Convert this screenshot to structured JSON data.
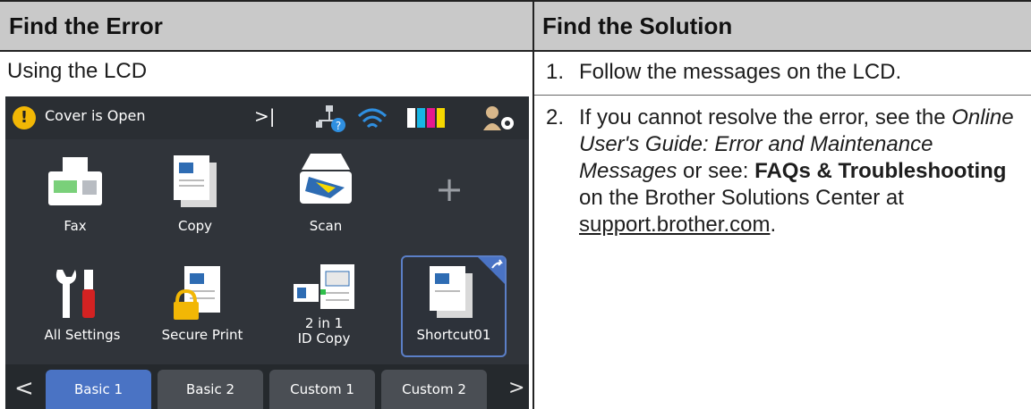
{
  "table": {
    "col1_header": "Find the Error",
    "col2_header": "Find the Solution"
  },
  "error": {
    "intro": "Using the LCD",
    "lcd": {
      "status_message": "Cover is Open",
      "status_forward": ">|",
      "tiles": [
        {
          "label": "Fax"
        },
        {
          "label": "Copy"
        },
        {
          "label": "Scan"
        },
        {
          "label": "+"
        },
        {
          "label": "All Settings"
        },
        {
          "label": "Secure Print"
        },
        {
          "label_line1": "2 in 1",
          "label_line2": "ID Copy"
        },
        {
          "label": "Shortcut01"
        }
      ],
      "tabs": [
        "Basic 1",
        "Basic 2",
        "Custom 1",
        "Custom 2"
      ],
      "tab_prev": "<",
      "tab_next": ">",
      "colors": {
        "active_tab": "#4a73c4",
        "warning": "#f2b705",
        "wifi": "#2f8fe0"
      }
    }
  },
  "solution": {
    "step1_num": "1.",
    "step1_text": "Follow the messages on the LCD.",
    "step2_num": "2.",
    "step2_a": "If you cannot resolve the error, see the ",
    "step2_guide": "Online User's Guide",
    "step2_colon": ": ",
    "step2_section": "Error and Maintenance Messages",
    "step2_b": " or see: ",
    "step2_faq": "FAQs & Troubleshooting",
    "step2_c": " on the Brother Solutions Center at ",
    "step2_link": "support.brother.com",
    "step2_end": "."
  }
}
